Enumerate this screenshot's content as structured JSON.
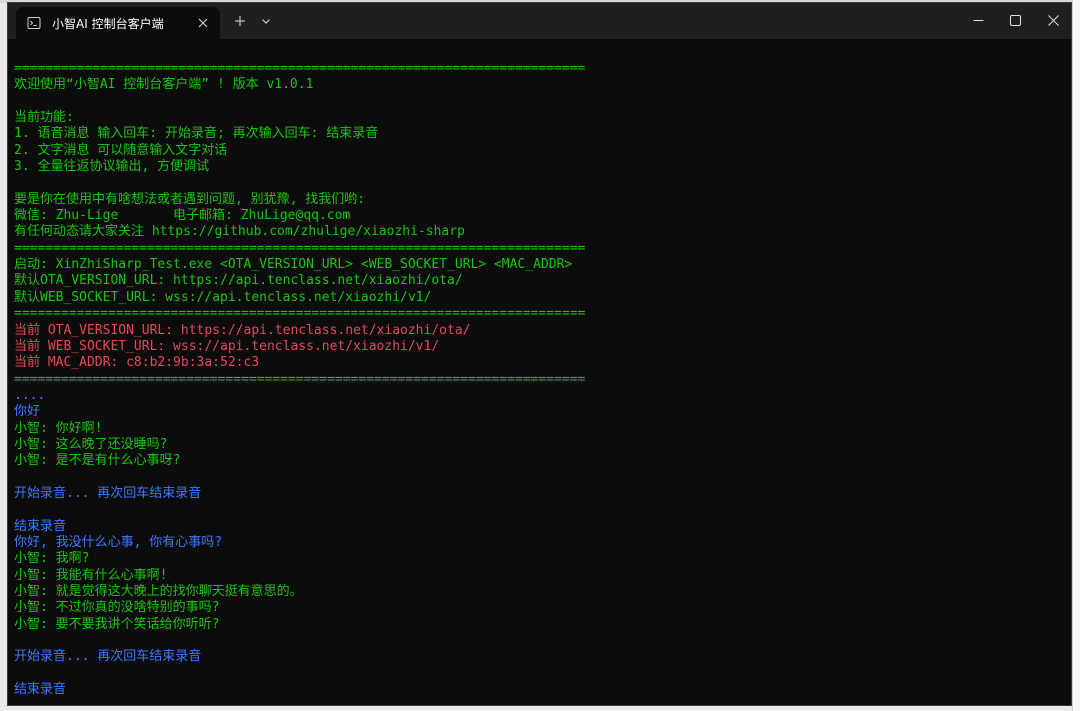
{
  "window": {
    "tab_title": "小智AI 控制台客户端"
  },
  "icons": {
    "tab": "terminal-icon",
    "tab_close": "close-icon",
    "new_tab": "plus-icon",
    "tab_menu": "chevron-down-icon",
    "minimize": "minimize-icon",
    "maximize": "maximize-icon",
    "close": "close-icon"
  },
  "colors": {
    "green": "#16c60c",
    "red": "#e74856",
    "blue": "#3b78ff",
    "background": "#0c0c0c"
  },
  "terminal": {
    "lines": [
      {
        "text": "=========================================================================",
        "color": "green"
      },
      {
        "text": "欢迎使用“小智AI 控制台客户端” ! 版本 v1.0.1",
        "color": "green"
      },
      {
        "text": "",
        "color": "green"
      },
      {
        "text": "当前功能:",
        "color": "green"
      },
      {
        "text": "1. 语音消息 输入回车: 开始录音; 再次输入回车: 结束录音",
        "color": "green"
      },
      {
        "text": "2. 文字消息 可以随意输入文字对话",
        "color": "green"
      },
      {
        "text": "3. 全量往返协议输出, 方便调试",
        "color": "green"
      },
      {
        "text": "",
        "color": "green"
      },
      {
        "text": "要是你在使用中有啥想法或者遇到问题, 别犹豫, 找我们哟:",
        "color": "green"
      },
      {
        "text": "微信: Zhu-Lige       电子邮箱: ZhuLige@qq.com",
        "color": "green"
      },
      {
        "text": "有任何动态请大家关注 https://github.com/zhulige/xiaozhi-sharp",
        "color": "green"
      },
      {
        "text": "=========================================================================",
        "color": "green"
      },
      {
        "text": "启动: XinZhiSharp_Test.exe <OTA_VERSION_URL> <WEB_SOCKET_URL> <MAC_ADDR>",
        "color": "green"
      },
      {
        "text": "默认OTA_VERSION_URL: https://api.tenclass.net/xiaozhi/ota/",
        "color": "green"
      },
      {
        "text": "默认WEB_SOCKET_URL: wss://api.tenclass.net/xiaozhi/v1/",
        "color": "green"
      },
      {
        "text": "=========================================================================",
        "color": "green"
      },
      {
        "text": "当前 OTA_VERSION_URL: https://api.tenclass.net/xiaozhi/ota/",
        "color": "red"
      },
      {
        "text": "当前 WEB_SOCKET_URL: wss://api.tenclass.net/xiaozhi/v1/",
        "color": "red"
      },
      {
        "text": "当前 MAC_ADDR: c8:b2:9b:3a:52:c3",
        "color": "red"
      },
      {
        "text": "=========================================================================",
        "color": "green"
      },
      {
        "text": "....",
        "color": "blue"
      },
      {
        "text": "你好",
        "color": "blue"
      },
      {
        "text": "小智: 你好啊!",
        "color": "green"
      },
      {
        "text": "小智: 这么晚了还没睡吗?",
        "color": "green"
      },
      {
        "text": "小智: 是不是有什么心事呀?",
        "color": "green"
      },
      {
        "text": "",
        "color": "green"
      },
      {
        "text": "开始录音... 再次回车结束录音",
        "color": "blue"
      },
      {
        "text": "",
        "color": "green"
      },
      {
        "text": "结束录音",
        "color": "blue"
      },
      {
        "text": "你好, 我没什么心事, 你有心事吗?",
        "color": "blue"
      },
      {
        "text": "小智: 我啊?",
        "color": "green"
      },
      {
        "text": "小智: 我能有什么心事啊!",
        "color": "green"
      },
      {
        "text": "小智: 就是觉得这大晚上的找你聊天挺有意思的。",
        "color": "green"
      },
      {
        "text": "小智: 不过你真的没啥特别的事吗?",
        "color": "green"
      },
      {
        "text": "小智: 要不要我讲个笑话给你听听?",
        "color": "green"
      },
      {
        "text": "",
        "color": "green"
      },
      {
        "text": "开始录音... 再次回车结束录音",
        "color": "blue"
      },
      {
        "text": "",
        "color": "green"
      },
      {
        "text": "结束录音",
        "color": "blue"
      }
    ]
  }
}
